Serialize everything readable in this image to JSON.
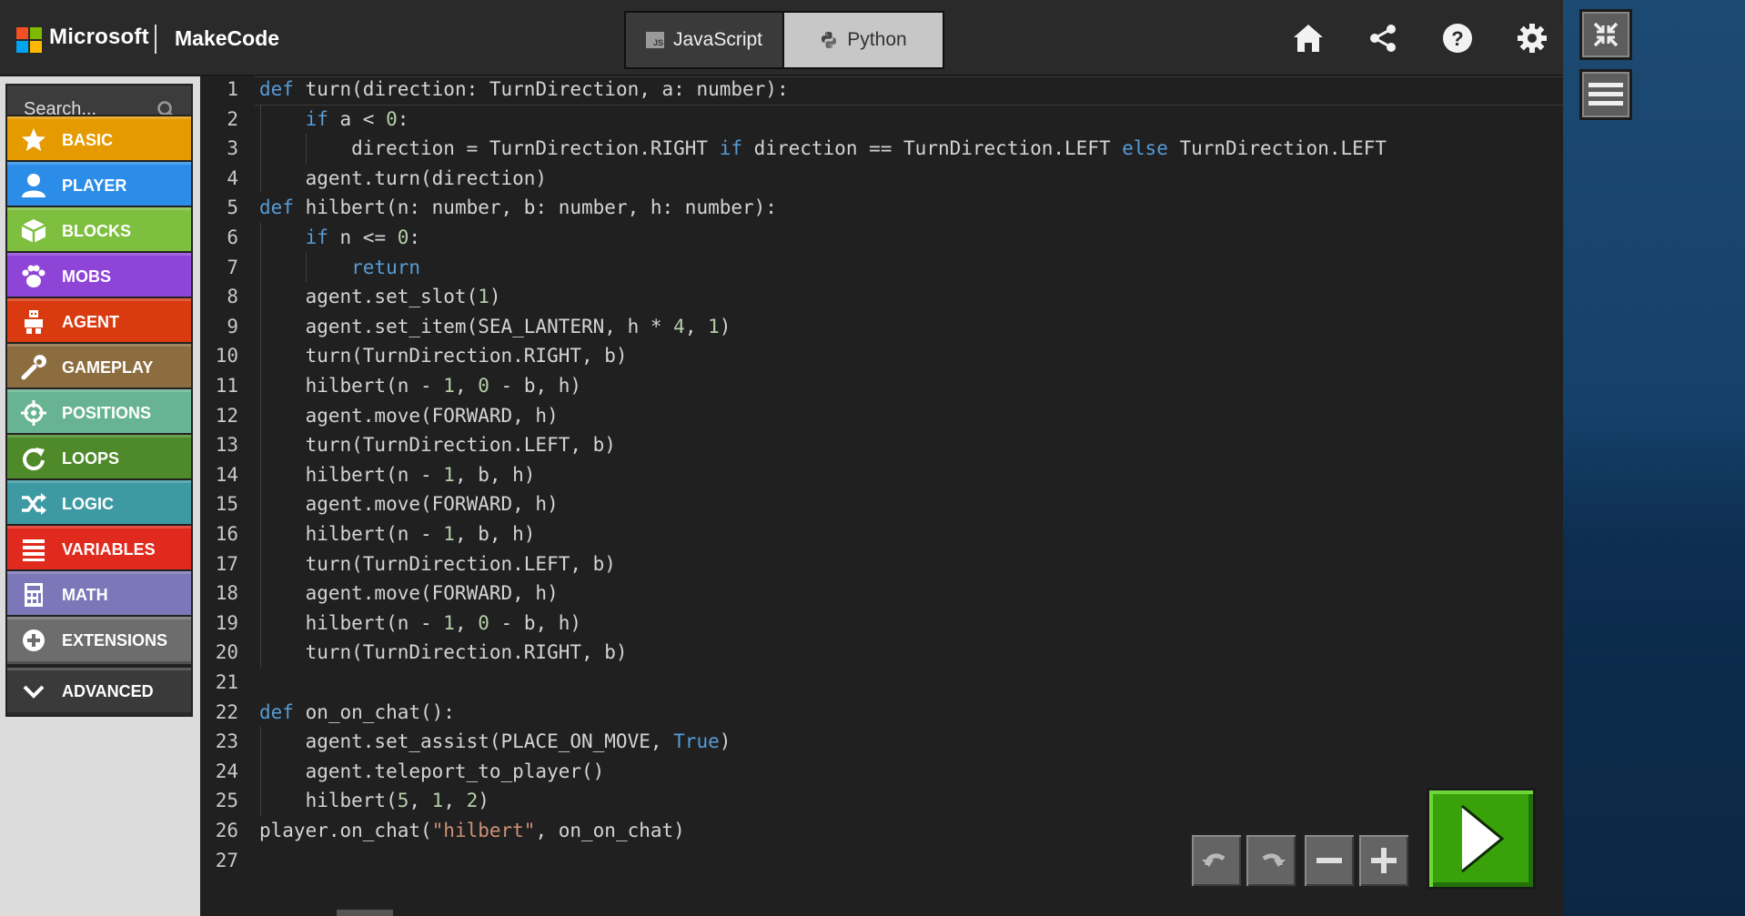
{
  "header": {
    "brand": "Microsoft",
    "product": "MakeCode",
    "logo_colors": [
      "#f25022",
      "#7fba00",
      "#00a4ef",
      "#ffb900"
    ],
    "lang_tabs": [
      {
        "label": "JavaScript",
        "badge": "JS",
        "selected": false
      },
      {
        "label": "Python",
        "selected": true
      }
    ],
    "icons": [
      "home-icon",
      "share-icon",
      "help-icon",
      "settings-icon"
    ]
  },
  "side_buttons": [
    "fullscreen-exit-icon",
    "menu-icon"
  ],
  "toolbox": {
    "search_placeholder": "Search...",
    "categories": [
      {
        "label": "BASIC",
        "color": "#e59a00",
        "icon": "star-icon"
      },
      {
        "label": "PLAYER",
        "color": "#2b8de8",
        "icon": "person-icon"
      },
      {
        "label": "BLOCKS",
        "color": "#7fbf3f",
        "icon": "cube-icon"
      },
      {
        "label": "MOBS",
        "color": "#8e44d6",
        "icon": "paw-icon"
      },
      {
        "label": "AGENT",
        "color": "#d93a10",
        "icon": "robot-icon"
      },
      {
        "label": "GAMEPLAY",
        "color": "#8c6d3f",
        "icon": "wrench-icon"
      },
      {
        "label": "POSITIONS",
        "color": "#68b492",
        "icon": "crosshair-icon"
      },
      {
        "label": "LOOPS",
        "color": "#4e8a2a",
        "icon": "loop-icon"
      },
      {
        "label": "LOGIC",
        "color": "#3d9aa3",
        "icon": "shuffle-icon"
      },
      {
        "label": "VARIABLES",
        "color": "#e02a1e",
        "icon": "list-icon"
      },
      {
        "label": "MATH",
        "color": "#7b77b8",
        "icon": "calculator-icon"
      },
      {
        "label": "EXTENSIONS",
        "color": "#6d6d6d",
        "icon": "plus-circle-icon"
      },
      {
        "label": "ADVANCED",
        "color": "#3a3a3a",
        "icon": "chevron-down-icon"
      }
    ]
  },
  "editor": {
    "language": "python",
    "lines": [
      "1",
      "2",
      "3",
      "4",
      "5",
      "6",
      "7",
      "8",
      "9",
      "10",
      "11",
      "12",
      "13",
      "14",
      "15",
      "16",
      "17",
      "18",
      "19",
      "20",
      "21",
      "22",
      "23",
      "24",
      "25",
      "26",
      "27"
    ],
    "code": [
      "def turn(direction: TurnDirection, a: number):",
      "    if a < 0:",
      "        direction = TurnDirection.RIGHT if direction == TurnDirection.LEFT else TurnDirection.LEFT",
      "    agent.turn(direction)",
      "def hilbert(n: number, b: number, h: number):",
      "    if n <= 0:",
      "        return",
      "    agent.set_slot(1)",
      "    agent.set_item(SEA_LANTERN, h * 4, 1)",
      "    turn(TurnDirection.RIGHT, b)",
      "    hilbert(n - 1, 0 - b, h)",
      "    agent.move(FORWARD, h)",
      "    turn(TurnDirection.LEFT, b)",
      "    hilbert(n - 1, b, h)",
      "    agent.move(FORWARD, h)",
      "    hilbert(n - 1, b, h)",
      "    turn(TurnDirection.LEFT, b)",
      "    agent.move(FORWARD, h)",
      "    hilbert(n - 1, 0 - b, h)",
      "    turn(TurnDirection.RIGHT, b)",
      "",
      "def on_on_chat():",
      "    agent.set_assist(PLACE_ON_MOVE, True)",
      "    agent.teleport_to_player()",
      "    hilbert(5, 1, 2)",
      "player.on_chat(\"hilbert\", on_on_chat)",
      ""
    ]
  },
  "controls": [
    "undo-icon",
    "redo-icon",
    "zoom-out-icon",
    "zoom-in-icon",
    "run-icon"
  ]
}
